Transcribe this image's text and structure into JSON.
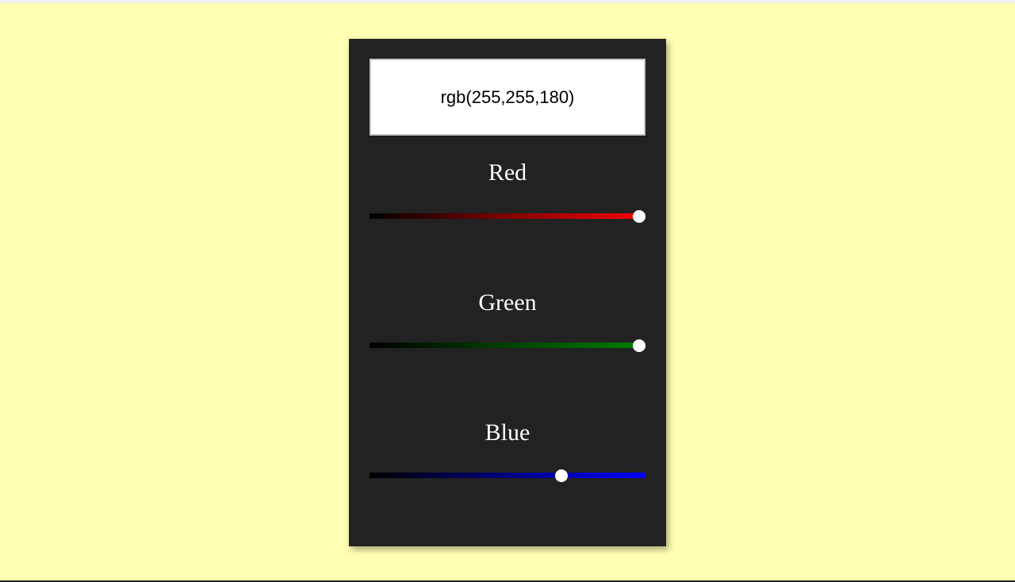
{
  "page": {
    "background": "#ffffb4",
    "panel_background": "#222222"
  },
  "display": {
    "text": "rgb(255,255,180)",
    "background": "#ffffff"
  },
  "sliders": [
    {
      "label": "Red",
      "value": 255,
      "max": 255,
      "color": "#ff0000"
    },
    {
      "label": "Green",
      "value": 255,
      "max": 255,
      "color": "#008000"
    },
    {
      "label": "Blue",
      "value": 180,
      "max": 255,
      "color": "#0000ff"
    }
  ]
}
